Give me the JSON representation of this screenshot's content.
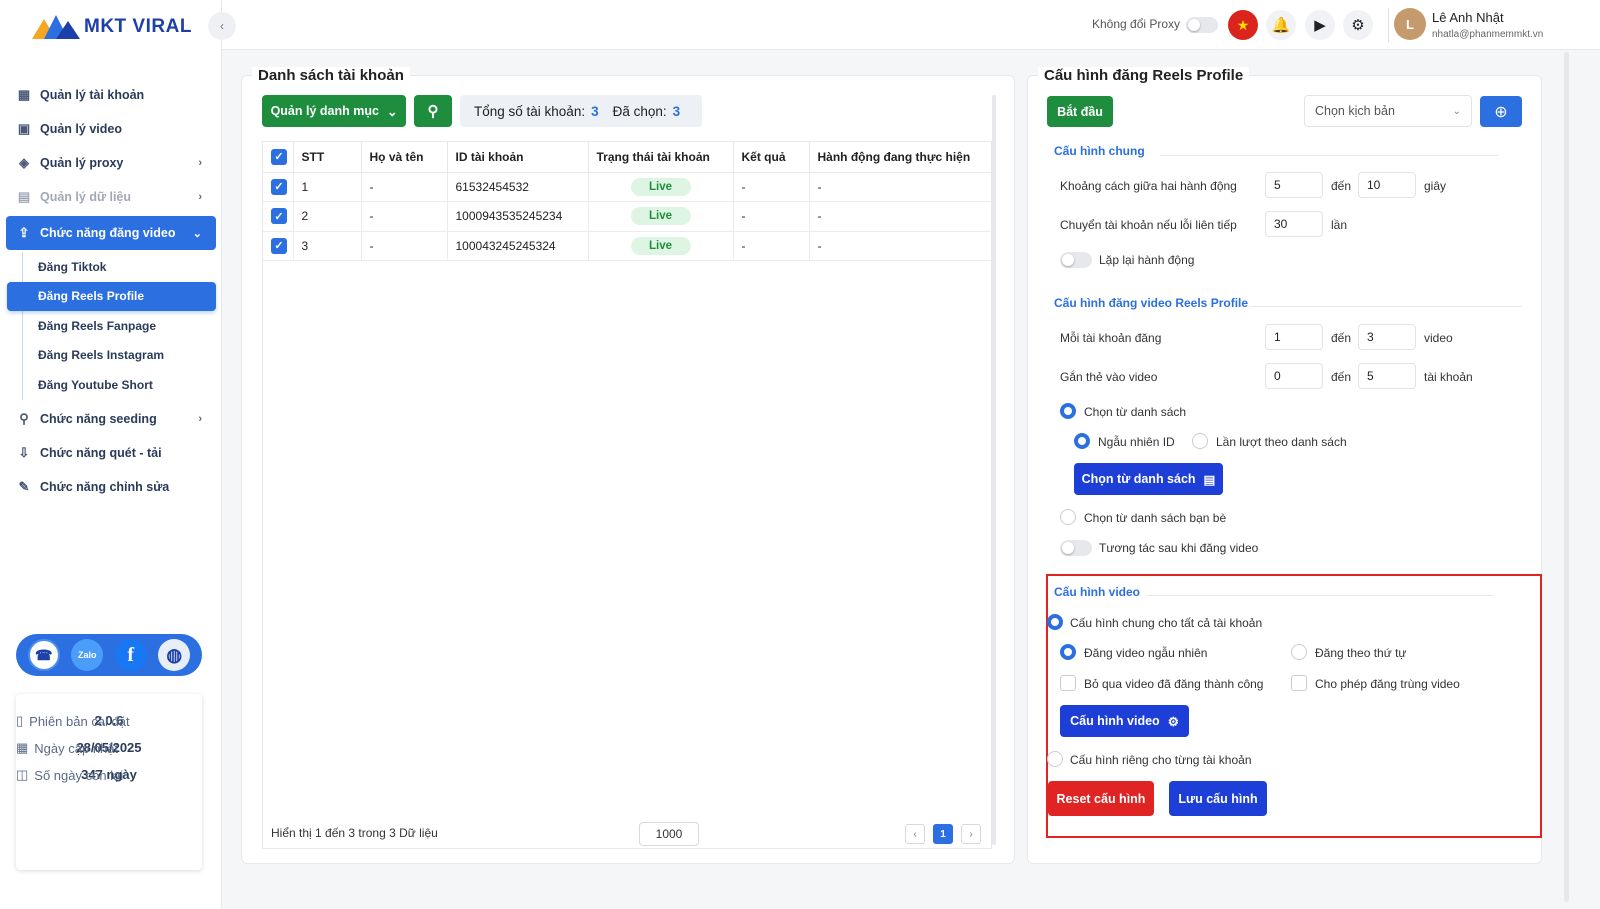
{
  "app": {
    "name": "MKT VIRAL"
  },
  "sidebar": {
    "menu": [
      {
        "label": "Quản lý tài khoản",
        "icon": "grid-icon"
      },
      {
        "label": "Quản lý video",
        "icon": "video-icon"
      },
      {
        "label": "Quản lý proxy",
        "icon": "layers-icon",
        "has_children": true
      },
      {
        "label": "Quản lý dữ liệu",
        "icon": "clipboard-icon",
        "has_children": true,
        "disabled": true
      },
      {
        "label": "Chức năng đăng video",
        "icon": "upload-icon",
        "has_children": true,
        "active": true
      }
    ],
    "submenu": [
      {
        "label": "Đăng Tiktok"
      },
      {
        "label": "Đăng Reels Profile",
        "active": true
      },
      {
        "label": "Đăng Reels Fanpage"
      },
      {
        "label": "Đăng Reels Instagram"
      },
      {
        "label": "Đăng Youtube Short"
      }
    ],
    "menu_bottom": [
      {
        "label": "Chức năng seeding",
        "icon": "seeding-icon",
        "has_children": true
      },
      {
        "label": "Chức năng quét - tải",
        "icon": "download-icon"
      },
      {
        "label": "Chức năng chỉnh sửa",
        "icon": "pencil-icon"
      }
    ],
    "social": {
      "zalo": "Zalo"
    },
    "info": {
      "version_label": "Phiên bản cài đặt",
      "version": "2.0.6",
      "updated_label": "Ngày cập nhật",
      "updated": "28/05/2025",
      "days_label": "Số ngày còn lại",
      "days": "347 ngày"
    }
  },
  "header": {
    "proxy_label": "Không đổi Proxy",
    "user_name": "Lê Anh Nhật",
    "user_email": "nhatla@phanmemmkt.vn"
  },
  "accounts": {
    "title": "Danh sách tài khoản",
    "category_button": "Quản lý danh mục",
    "total_label": "Tổng số tài khoản:",
    "total": "3",
    "selected_label": "Đã chọn:",
    "selected": "3",
    "columns": [
      "STT",
      "Họ và tên",
      "ID tài khoản",
      "Trạng thái tài khoản",
      "Kết quả",
      "Hành động đang thực hiện"
    ],
    "rows": [
      {
        "stt": "1",
        "name": "-",
        "id": "61532454532",
        "status": "Live",
        "result": "-",
        "action": "-"
      },
      {
        "stt": "2",
        "name": "-",
        "id": "1000943535245234",
        "status": "Live",
        "result": "-",
        "action": "-"
      },
      {
        "stt": "3",
        "name": "-",
        "id": "100043245245324",
        "status": "Live",
        "result": "-",
        "action": "-"
      }
    ],
    "footer_text": "Hiển thị 1 đến 3 trong 3 Dữ liệu",
    "page_size": "1000",
    "current_page": "1"
  },
  "config": {
    "title": "Cấu hình đăng Reels Profile",
    "start_button": "Bắt đầu",
    "script_placeholder": "Chọn kịch bản",
    "general": {
      "title": "Cấu hình chung",
      "delay_label": "Khoảng cách giữa hai hành động",
      "delay_from": "5",
      "delay_to": "10",
      "to_label": "đến",
      "delay_unit": "giây",
      "switch_label": "Chuyển tài khoản nếu lỗi liên tiếp",
      "switch_value": "30",
      "switch_unit": "lần",
      "repeat_label": "Lặp lại hành động"
    },
    "reels": {
      "title": "Cấu hình đăng video Reels Profile",
      "per_account_label": "Mỗi tài khoản đăng",
      "per_from": "1",
      "per_to": "3",
      "per_unit": "video",
      "tag_label": "Gắn thẻ vào video",
      "tag_from": "0",
      "tag_to": "5",
      "tag_unit": "tài khoản",
      "from_list_label": "Chọn từ danh sách",
      "random_id_label": "Ngẫu nhiên ID",
      "sequential_label": "Lần lượt theo danh sách",
      "from_list_button": "Chọn từ danh sách",
      "from_friends_label": "Chọn từ danh sách bạn bè",
      "interact_label": "Tương tác sau khi đăng video"
    },
    "video": {
      "title": "Cấu hình video",
      "common_label": "Cấu hình chung cho tất cả tài khoản",
      "random_label": "Đăng video ngẫu nhiên",
      "ordered_label": "Đăng theo thứ tự",
      "skip_label": "Bỏ qua video đã đăng thành công",
      "duplicate_label": "Cho phép đăng trùng video",
      "config_button": "Cấu hình video",
      "per_account_label": "Cấu hình riêng cho từng tài khoản"
    },
    "reset_button": "Reset cấu hình",
    "save_button": "Lưu cấu hình"
  }
}
